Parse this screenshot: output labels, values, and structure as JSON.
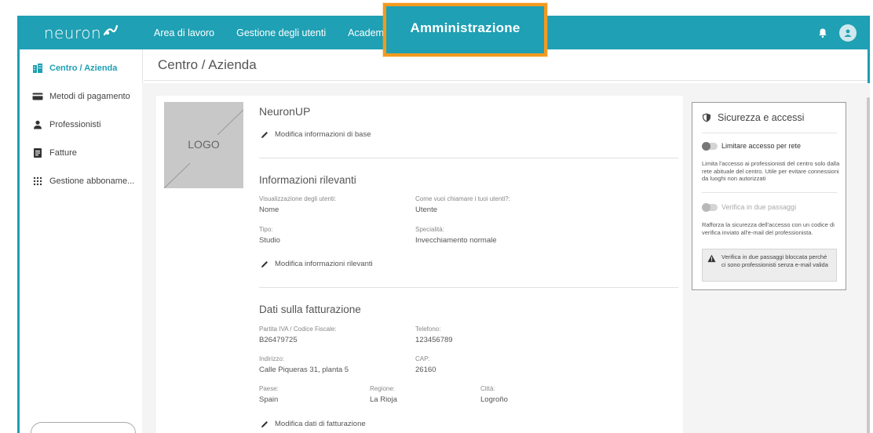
{
  "topbar": {
    "brand": "neuron",
    "nav": [
      "Area di lavoro",
      "Gestione degli utenti",
      "Academy",
      "Amministrazione"
    ],
    "highlight_color": "#f29a1f",
    "bar_color": "#1fa0b4"
  },
  "sidebar": {
    "items": [
      {
        "label": "Centro / Azienda",
        "icon": "building-icon",
        "active": true
      },
      {
        "label": "Metodi di pagamento",
        "icon": "credit-card-icon",
        "active": false
      },
      {
        "label": "Professionisti",
        "icon": "person-icon",
        "active": false
      },
      {
        "label": "Fatture",
        "icon": "invoice-icon",
        "active": false
      },
      {
        "label": "Gestione abboname...",
        "icon": "grid-dots-icon",
        "active": false
      }
    ]
  },
  "page": {
    "title": "Centro / Azienda"
  },
  "company": {
    "logo_label": "LOGO",
    "name": "NeuronUP",
    "edit_basic": "Modifica informazioni di base"
  },
  "relevant": {
    "title": "Informazioni rilevanti",
    "fields": [
      {
        "label": "Visualizzazione degli utenti:",
        "value": "Nome"
      },
      {
        "label": "Come vuoi chiamare i tuoi utenti?:",
        "value": "Utente"
      },
      {
        "label": "Tipo:",
        "value": "Studio"
      },
      {
        "label": "Specialità:",
        "value": "Invecchiamento normale"
      }
    ],
    "edit": "Modifica informazioni rilevanti"
  },
  "billing": {
    "title": "Dati sulla fatturazione",
    "fields": [
      {
        "label": "Partita IVA / Codice Fiscale:",
        "value": "B26479725"
      },
      {
        "label": "Telefono:",
        "value": "123456789"
      },
      {
        "label": "Indirizzo:",
        "value": "Calle Piqueras 31, planta 5"
      },
      {
        "label": "CAP:",
        "value": "26160"
      },
      {
        "label": "Paese:",
        "value": "Spain"
      },
      {
        "label": "Regione:",
        "value": "La Rioja"
      },
      {
        "label": "Città:",
        "value": "Logroño"
      }
    ],
    "edit": "Modifica dati di fatturazione"
  },
  "security": {
    "title": "Sicurezza e accessi",
    "network_toggle": "Limitare accesso per rete",
    "network_desc": "Limita l'accesso ai professionisti del centro solo dalla rete abituale del centro. Utile per evitare connessioni da luoghi non autorizzati",
    "twofa_toggle": "Verifica in due passaggi",
    "twofa_desc": "Rafforza la sicurezza dell'accesso con un codice di verifica inviato all'e-mail del professionista.",
    "warning": "Verifica in due passaggi bloccata perché ci sono professionisti senza e-mail valida"
  }
}
